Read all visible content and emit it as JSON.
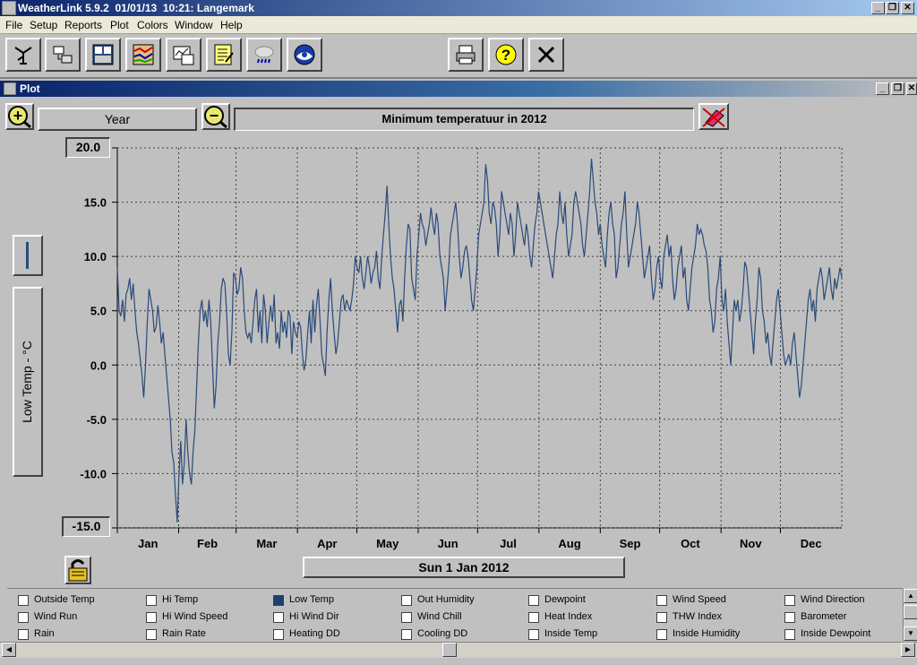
{
  "app": {
    "title": "WeatherLink 5.9.2  01/01/13  10:21: Langemark",
    "minimize_glyph": "_",
    "restore_glyph": "❐",
    "close_glyph": "✕"
  },
  "menu": [
    "File",
    "Setup",
    "Reports",
    "Plot",
    "Colors",
    "Window",
    "Help"
  ],
  "toolbar": {
    "left_buttons": [
      "weather-station-icon",
      "download-icon",
      "bulletin-icon",
      "plot-icon",
      "browse-icon",
      "notes-icon",
      "strip-chart-icon",
      "noaa-icon"
    ],
    "right_buttons": [
      "print-icon",
      "help-icon",
      "exit-icon"
    ],
    "help_glyph": "?",
    "exit_glyph": "✕"
  },
  "plot_window": {
    "title": "Plot",
    "zoom_in_glyph": "+",
    "zoom_out_glyph": "−",
    "span_label": "Year",
    "plot_title": "Minimum temperatuur in 2012",
    "y_axis_label": "Low Temp - °C",
    "y_max_label": "20.0",
    "y_min_label": "-15.0",
    "date_label": "Sun 1 Jan 2012"
  },
  "chart_data": {
    "type": "line",
    "title": "Minimum temperatuur in 2012",
    "ylabel": "Low Temp - °C",
    "xlabel": "",
    "ylim": [
      -15,
      20
    ],
    "yticks": [
      "20.0",
      "15.0",
      "10.0",
      "5.0",
      "0.0",
      "-5.0",
      "-10.0",
      "-15.0"
    ],
    "ytick_values": [
      20,
      15,
      10,
      5,
      0,
      -5,
      -10,
      -15
    ],
    "months": [
      "Jan",
      "Feb",
      "Mar",
      "Apr",
      "May",
      "Jun",
      "Jul",
      "Aug",
      "Sep",
      "Oct",
      "Nov",
      "Dec"
    ],
    "grid": true,
    "color": "#2a4a7a",
    "series": [
      {
        "values": [
          9,
          5,
          4.5,
          6,
          4,
          6.5,
          7,
          8,
          6,
          7.5,
          5,
          3,
          2,
          0.5,
          -1,
          -3,
          0,
          4,
          7,
          6,
          5,
          3,
          3.5,
          5.5,
          4,
          2,
          3,
          1,
          -1,
          -3,
          -5,
          -8,
          -9,
          -12,
          -14.5,
          -10,
          -7,
          -11,
          -9,
          -5,
          -8,
          -10,
          -11,
          -8,
          -6,
          -2,
          2,
          5,
          6,
          4,
          5,
          3.5,
          6,
          4,
          0,
          -4,
          -2,
          2,
          4,
          7,
          8,
          7.5,
          5,
          1,
          0,
          3,
          8.5,
          8,
          6.5,
          7,
          9,
          8,
          5,
          3,
          2.5,
          3,
          2,
          4,
          6,
          7,
          3,
          5,
          2,
          6.5,
          5,
          2,
          4,
          5.5,
          4,
          6.5,
          2,
          3,
          1.5,
          5,
          3,
          4,
          2.5,
          5,
          4.5,
          1,
          4,
          3,
          2.5,
          4,
          3.5,
          1,
          -0.5,
          0.5,
          3,
          5,
          2,
          6,
          3,
          5.5,
          7,
          4,
          1,
          0,
          -1,
          3,
          6,
          8,
          5,
          3,
          1,
          2,
          4,
          6,
          6.5,
          5,
          6,
          5.5,
          5,
          6,
          7.5,
          10,
          9,
          8.5,
          10,
          8,
          7,
          8.5,
          10,
          9,
          7.5,
          8.5,
          9,
          10.5,
          8,
          7,
          10,
          12,
          14,
          16.5,
          13,
          10,
          8,
          7,
          5,
          3,
          5.5,
          6,
          4,
          8,
          11,
          13,
          12.5,
          8,
          7,
          6,
          10,
          12,
          14,
          13,
          12.5,
          11,
          12,
          13,
          14.5,
          13,
          12,
          14,
          13,
          10,
          9,
          8,
          5,
          7,
          9,
          12,
          13,
          14,
          15,
          13,
          10,
          8,
          9,
          10.5,
          11,
          10,
          8,
          6,
          5,
          7,
          9,
          12,
          13,
          14,
          15,
          18.5,
          17,
          14,
          13,
          15,
          14.5,
          13,
          10,
          12,
          16,
          15,
          14,
          13,
          12,
          14,
          13,
          10,
          12,
          15,
          14,
          13,
          12,
          11,
          13,
          12,
          10,
          9,
          11,
          13,
          14,
          16,
          15,
          14,
          13,
          12,
          11,
          10,
          9,
          8,
          10,
          12,
          13,
          16,
          14,
          13,
          15,
          12,
          10,
          11,
          12,
          15,
          16,
          15,
          14,
          13,
          11,
          10,
          12,
          14,
          16,
          19,
          17,
          15,
          14,
          12,
          13,
          11,
          10,
          9,
          12,
          14,
          15,
          13,
          12,
          8,
          9,
          11,
          13,
          14,
          16,
          12,
          9,
          10,
          11,
          12,
          13,
          15,
          14,
          12,
          10,
          8,
          9,
          10,
          11,
          8,
          6,
          7,
          9,
          10,
          8,
          7,
          10,
          11,
          12,
          10,
          11,
          8,
          6,
          7,
          9,
          10,
          11,
          8,
          9,
          6,
          5,
          7,
          9,
          10,
          11,
          13,
          12,
          12.5,
          12,
          11,
          10.5,
          9,
          6,
          5,
          3,
          4,
          7,
          8,
          10,
          6,
          5,
          7,
          4,
          2,
          0,
          3,
          6,
          5,
          6,
          4,
          5,
          7,
          9.5,
          9,
          7,
          5,
          3,
          1,
          4,
          6,
          9,
          8,
          5,
          4,
          2,
          3,
          1,
          0,
          2,
          4,
          6,
          7,
          5,
          3,
          1,
          0,
          0.5,
          1,
          0,
          2,
          3,
          1,
          -1,
          -3,
          -2,
          0,
          2,
          4,
          6,
          7,
          5,
          6,
          4,
          7,
          8,
          9,
          8,
          6,
          7,
          8,
          9,
          7,
          6,
          8,
          7,
          8,
          9,
          8
        ]
      }
    ]
  },
  "legend": {
    "items": [
      {
        "label": "Outside Temp",
        "checked": false
      },
      {
        "label": "Hi Temp",
        "checked": false
      },
      {
        "label": "Low Temp",
        "checked": true
      },
      {
        "label": "Out Humidity",
        "checked": false
      },
      {
        "label": "Dewpoint",
        "checked": false
      },
      {
        "label": "Wind Speed",
        "checked": false
      },
      {
        "label": "Wind Direction",
        "checked": false
      },
      {
        "label": "Wind Run",
        "checked": false
      },
      {
        "label": "Hi Wind Speed",
        "checked": false
      },
      {
        "label": "Hi Wind Dir",
        "checked": false
      },
      {
        "label": "Wind Chill",
        "checked": false
      },
      {
        "label": "Heat Index",
        "checked": false
      },
      {
        "label": "THW Index",
        "checked": false
      },
      {
        "label": "Barometer",
        "checked": false
      },
      {
        "label": "Rain",
        "checked": false
      },
      {
        "label": "Rain Rate",
        "checked": false
      },
      {
        "label": "Heating DD",
        "checked": false
      },
      {
        "label": "Cooling DD",
        "checked": false
      },
      {
        "label": "Inside Temp",
        "checked": false
      },
      {
        "label": "Inside Humidity",
        "checked": false
      },
      {
        "label": "Inside Dewpoint",
        "checked": false
      }
    ]
  },
  "scroll": {
    "up_glyph": "▲",
    "down_glyph": "▼",
    "left_glyph": "◀",
    "right_glyph": "▶"
  }
}
